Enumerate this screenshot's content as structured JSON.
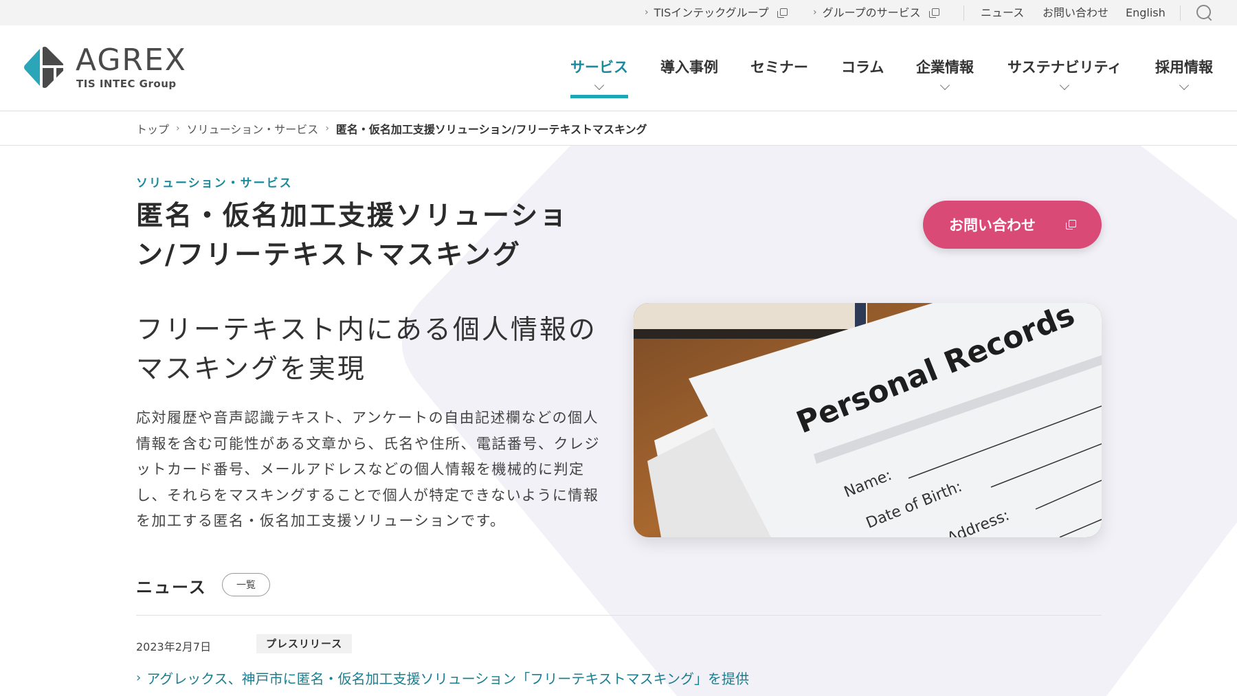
{
  "utility_bar": {
    "links": [
      {
        "label": "TISインテックグループ",
        "external": true
      },
      {
        "label": "グループのサービス",
        "external": true
      }
    ],
    "items": [
      "ニュース",
      "お問い合わせ",
      "English"
    ],
    "search_icon": "search-icon"
  },
  "header": {
    "logo": {
      "name": "AGREX",
      "sub": "TIS INTEC Group"
    },
    "nav": [
      {
        "label": "サービス",
        "active": true,
        "has_dropdown": true
      },
      {
        "label": "導入事例",
        "active": false,
        "has_dropdown": false
      },
      {
        "label": "セミナー",
        "active": false,
        "has_dropdown": false
      },
      {
        "label": "コラム",
        "active": false,
        "has_dropdown": false
      },
      {
        "label": "企業情報",
        "active": false,
        "has_dropdown": true
      },
      {
        "label": "サステナビリティ",
        "active": false,
        "has_dropdown": true
      },
      {
        "label": "採用情報",
        "active": false,
        "has_dropdown": true
      }
    ]
  },
  "breadcrumb": [
    "トップ",
    "ソリューション・サービス",
    "匿名・仮名加工支援ソリューション/フリーテキストマスキング"
  ],
  "main": {
    "category": "ソリューション・サービス",
    "title_line1": "匿名・仮名加工支援ソリューショ",
    "title_line2": "ン/フリーテキストマスキング",
    "contact_button": "お問い合わせ",
    "lead_line1": "フリーテキスト内にある個人情報の",
    "lead_line2": "マスキングを実現",
    "description": "応対履歴や音声認識テキスト、アンケートの自由記述欄などの個人情報を含む可能性がある文章から、氏名や住所、電話番号、クレジットカード番号、メールアドレスなどの個人情報を機械的に判定し、それらをマスキングすることで個人が特定できないように情報を加工する匿名・仮名加工支援ソリューションです。",
    "image": {
      "title_text": "Personal Records",
      "fields": [
        "Name:",
        "Date of Birth:",
        "Address:"
      ]
    }
  },
  "news": {
    "heading": "ニュース",
    "all_button": "一覧",
    "items": [
      {
        "date": "2023年2月7日",
        "tag": "プレスリリース",
        "title": "アグレックス、神戸市に匿名・仮名加工支援ソリューション「フリーテキストマスキング」を提供"
      }
    ]
  },
  "colors": {
    "accent": "#1a8a9c",
    "underline": "#1aa7b8",
    "cta": "#d94b76",
    "bg_shape": "#f1f1f7",
    "logo_teal": "#2aa6b8",
    "logo_gray": "#4a4a4a"
  }
}
